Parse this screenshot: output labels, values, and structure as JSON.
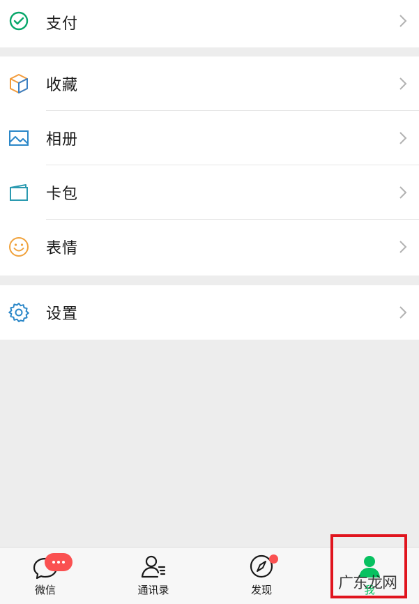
{
  "menu_groups": [
    {
      "items": [
        {
          "label": "支付",
          "icon": "wallet-check-icon"
        }
      ]
    },
    {
      "items": [
        {
          "label": "收藏",
          "icon": "cube-icon"
        },
        {
          "label": "相册",
          "icon": "picture-icon"
        },
        {
          "label": "卡包",
          "icon": "card-wallet-icon"
        },
        {
          "label": "表情",
          "icon": "smiley-icon"
        }
      ]
    },
    {
      "items": [
        {
          "label": "设置",
          "icon": "gear-icon"
        }
      ]
    }
  ],
  "tabbar": {
    "tabs": [
      {
        "label": "微信",
        "icon": "chat-bubble-icon",
        "badge": "···"
      },
      {
        "label": "通讯录",
        "icon": "contacts-icon"
      },
      {
        "label": "发现",
        "icon": "compass-icon"
      },
      {
        "label": "我",
        "icon": "person-icon",
        "active": true
      }
    ]
  },
  "watermark": "广东龙网",
  "colors": {
    "accent_green": "#07c160",
    "badge_red": "#fa5151",
    "highlight_red": "#e0141e",
    "background": "#ededed"
  }
}
